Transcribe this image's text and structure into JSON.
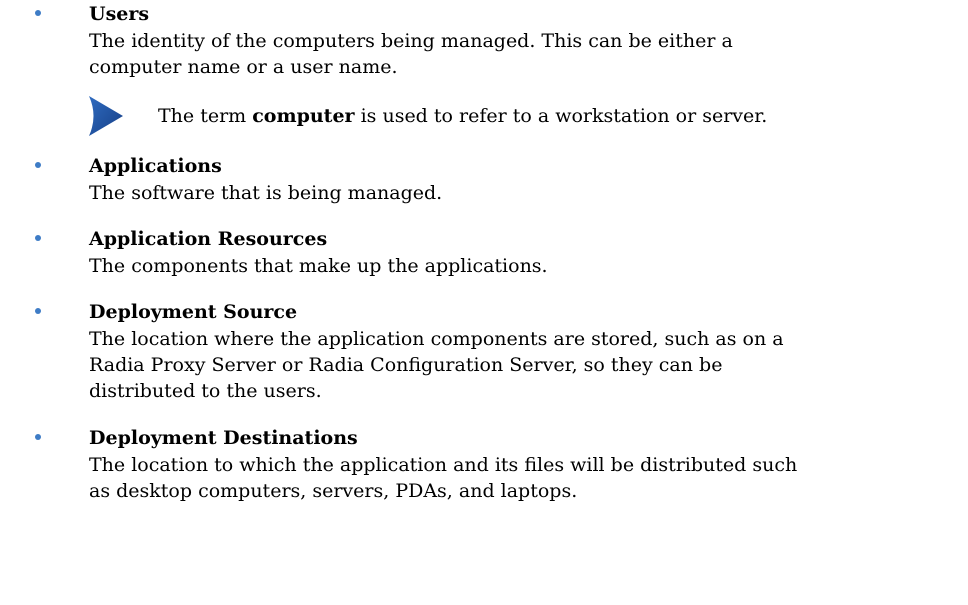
{
  "items": [
    {
      "term": "Users",
      "lines": [
        "The identity of the computers being managed. This can be either a",
        "computer name or a user name."
      ]
    },
    {
      "term": "Applications",
      "lines": [
        "The software that is being managed."
      ]
    },
    {
      "term": "Application Resources",
      "lines": [
        "The components that make up the applications."
      ]
    },
    {
      "term": "Deployment Source",
      "lines": [
        "The location where the application components are stored, such as on a",
        "Radia Proxy Server or Radia Configuration Server, so they can be",
        "distributed to the users."
      ]
    },
    {
      "term": "Deployment Destinations",
      "lines": [
        "The location to which the application and its files will be distributed such",
        "as desktop computers, servers, PDAs, and laptops."
      ]
    }
  ],
  "note": {
    "icon": "note-arrow-icon",
    "prefix": "The term ",
    "keyword": "computer",
    "suffix": " is used to refer to a workstation or server."
  },
  "colors": {
    "bullet": "#3e7cc6",
    "note_icon": "#1f4e9c",
    "text": "#000000"
  }
}
